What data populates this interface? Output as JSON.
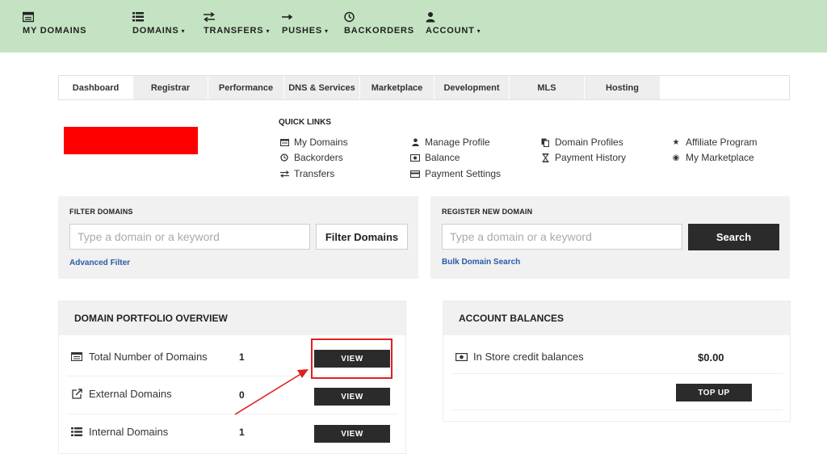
{
  "topnav": {
    "my_domains": "MY DOMAINS",
    "domains": "DOMAINS",
    "transfers": "TRANSFERS",
    "pushes": "PUSHES",
    "backorders": "BACKORDERS",
    "account": "ACCOUNT",
    "caret": "▾"
  },
  "tabs": [
    "Dashboard",
    "Registrar",
    "Performance",
    "DNS & Services",
    "Marketplace",
    "Development",
    "MLS",
    "Hosting"
  ],
  "quick_links": {
    "title": "QUICK LINKS",
    "col1": [
      "My Domains",
      "Backorders",
      "Transfers"
    ],
    "col2": [
      "Manage Profile",
      "Balance",
      "Payment Settings"
    ],
    "col3": [
      "Domain Profiles",
      "Payment History"
    ],
    "col4": [
      "Affiliate Program",
      "My Marketplace"
    ]
  },
  "filter": {
    "label": "FILTER DOMAINS",
    "placeholder": "Type a domain or a keyword",
    "button": "Filter Domains",
    "advanced": "Advanced Filter"
  },
  "register": {
    "label": "REGISTER NEW DOMAIN",
    "placeholder": "Type a domain or a keyword",
    "button": "Search",
    "bulk": "Bulk Domain Search"
  },
  "portfolio": {
    "title": "DOMAIN PORTFOLIO OVERVIEW",
    "rows": [
      {
        "label": "Total Number of Domains",
        "count": "1",
        "button": "VIEW"
      },
      {
        "label": "External Domains",
        "count": "0",
        "button": "VIEW"
      },
      {
        "label": "Internal Domains",
        "count": "1",
        "button": "VIEW"
      }
    ]
  },
  "balances": {
    "title": "ACCOUNT BALANCES",
    "row_label": "In Store credit balances",
    "amount": "$0.00",
    "topup": "TOP UP"
  },
  "colors": {
    "nav_bg": "#c4e3c3",
    "dark_button": "#2b2b2b",
    "link_blue": "#2a5aa6",
    "highlight_red": "#e02020",
    "logo_red": "#ff0000"
  }
}
